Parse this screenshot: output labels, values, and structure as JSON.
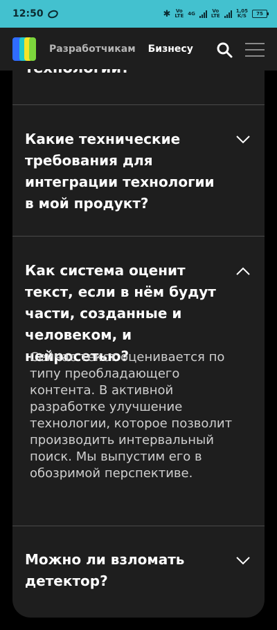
{
  "status_bar": {
    "time": "12:50",
    "net1_top": "Vo",
    "net1_bottom": "LTE",
    "net2": "4G",
    "net3_top": "Vo",
    "net3_bottom": "LTE",
    "speed_value": "1,05",
    "speed_unit": "K/S",
    "battery": "75",
    "bluetooth_glyph": "✱"
  },
  "header": {
    "nav_developers": "Разработчикам",
    "nav_business": "Бизнесу"
  },
  "faq": {
    "cut_question": "технологии?",
    "items": [
      {
        "question": "Какие технические требования для интеграции технологии в мой продукт?",
        "expanded": false
      },
      {
        "question": "Как система оценит текст, если в нём будут части, созданные и человеком, и нейросетью?",
        "expanded": true,
        "answer": "Сейчас текст оценивается по типу преобладающего контента. В активной разработке улучшение технологии, которое позволит производить интервальный поиск. Мы выпустим его в обозримой перспективе."
      },
      {
        "question": "Можно ли взломать детектор?",
        "expanded": false
      }
    ]
  },
  "colors": {
    "status_bar_bg": "#43c1cf",
    "card_bg": "#1e1e1e",
    "page_bg": "#000000"
  },
  "icons": [
    "bluetooth-icon",
    "signal-icon",
    "battery-icon",
    "search-icon",
    "menu-icon",
    "chevron-down-icon",
    "chevron-up-icon"
  ]
}
